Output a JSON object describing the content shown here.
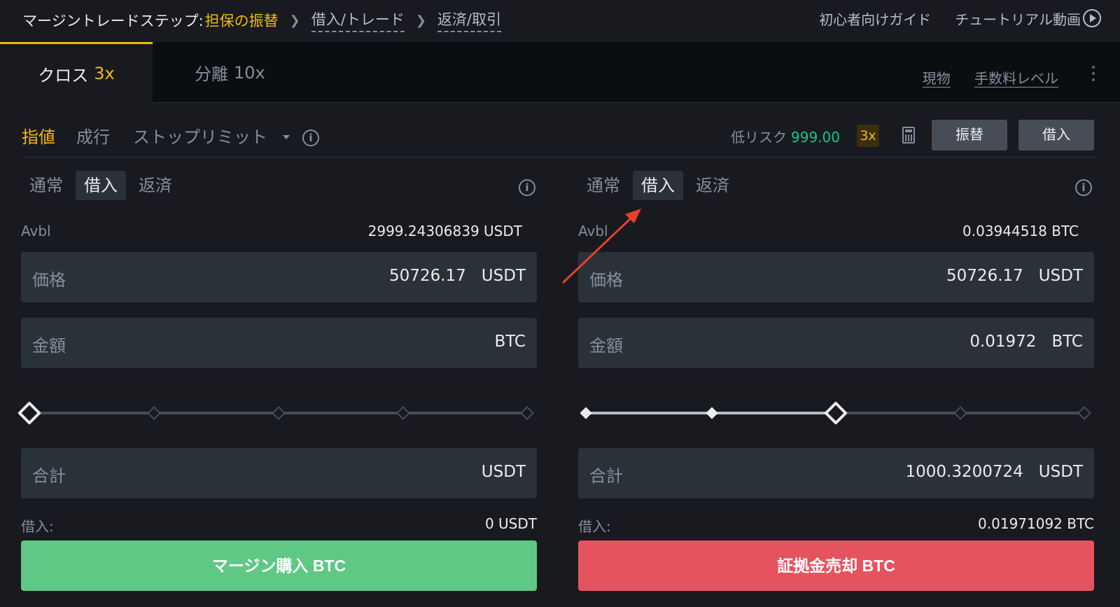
{
  "breadcrumb": {
    "prefix": "マージントレードステップ:",
    "active_step": "担保の振替",
    "steps": [
      "借入/トレード",
      "返済/取引"
    ]
  },
  "header_links": {
    "guide": "初心者向けガイド",
    "tutorial": "チュートリアル動画"
  },
  "margin_modes": [
    {
      "label": "クロス",
      "leverage": "3x",
      "active": true
    },
    {
      "label": "分離",
      "leverage": "10x",
      "active": false
    }
  ],
  "mode_links": {
    "spot": "現物",
    "fee_level": "手数料レベル"
  },
  "order_types": {
    "limit": "指値",
    "market": "成行",
    "stop_limit": "ストップリミット"
  },
  "risk": {
    "label": "低リスク",
    "value": "999.00",
    "leverage": "3x"
  },
  "actions": {
    "transfer": "振替",
    "borrow": "借入"
  },
  "buy_panel": {
    "subtabs": [
      "通常",
      "借入",
      "返済"
    ],
    "active_subtab": "借入",
    "avbl_label": "Avbl",
    "avbl_value": "2999.24306839 USDT",
    "price_label": "価格",
    "price_value": "50726.17",
    "price_unit": "USDT",
    "amount_label": "金額",
    "amount_value": "",
    "amount_unit": "BTC",
    "slider_percent": 0,
    "total_label": "合計",
    "total_value": "",
    "total_unit": "USDT",
    "borrow_label": "借入:",
    "borrow_value": "0 USDT",
    "button_label": "マージン購入 BTC"
  },
  "sell_panel": {
    "subtabs": [
      "通常",
      "借入",
      "返済"
    ],
    "active_subtab": "借入",
    "avbl_label": "Avbl",
    "avbl_value": "0.03944518 BTC",
    "price_label": "価格",
    "price_value": "50726.17",
    "price_unit": "USDT",
    "amount_label": "金額",
    "amount_value": "0.01972",
    "amount_unit": "BTC",
    "slider_percent": 50,
    "total_label": "合計",
    "total_value": "1000.3200724",
    "total_unit": "USDT",
    "borrow_label": "借入:",
    "borrow_value": "0.01971092 BTC",
    "button_label": "証拠金売却 BTC"
  },
  "colors": {
    "accent": "#f0b90b",
    "buy": "#5ec884",
    "sell": "#e5535f",
    "annotation": "#e8402c"
  }
}
